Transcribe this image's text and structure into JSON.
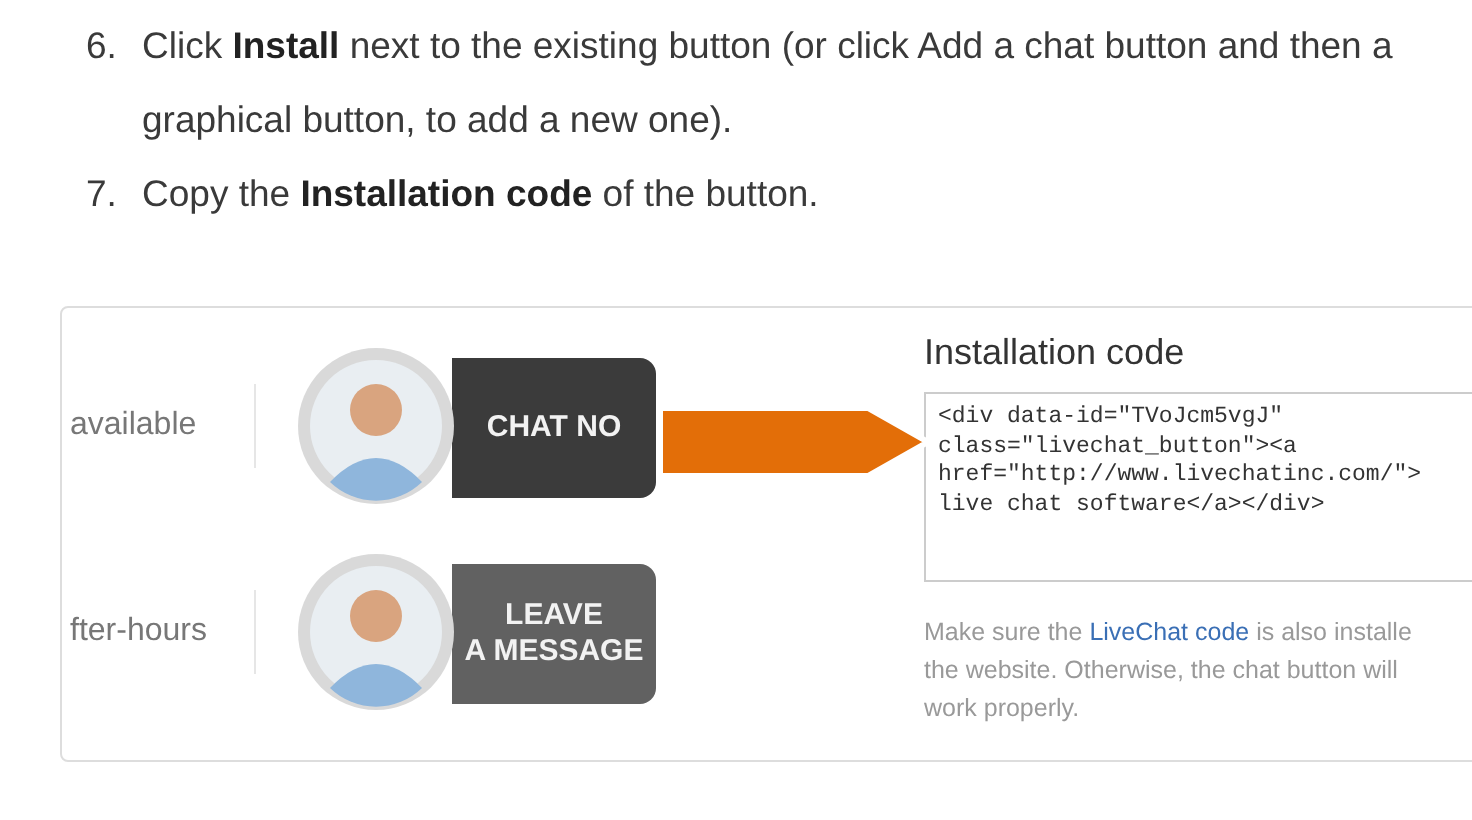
{
  "steps": [
    {
      "number": "6.",
      "text": "Click **Install** next to the existing button (or click Add a chat button and then a graphical button, to add a new one)."
    },
    {
      "number": "7.",
      "text": "Copy the **Installation code** of the button."
    }
  ],
  "buttons": [
    {
      "label": "available",
      "kind": "online",
      "text": "CHAT NO"
    },
    {
      "label": "fter-hours",
      "kind": "offline",
      "text": "LEAVE\nA MESSAGE"
    }
  ],
  "installation": {
    "title": "Installation code",
    "code": "<div data-id=\"TVoJcm5vgJ\"\nclass=\"livechat_button\"><a\nhref=\"http://www.livechatinc.com/\">\nlive chat software</a></div>",
    "help_before": "Make sure the ",
    "help_link": "LiveChat code",
    "help_after": " is also installe\nthe website. Otherwise, the chat button will\nwork properly."
  }
}
